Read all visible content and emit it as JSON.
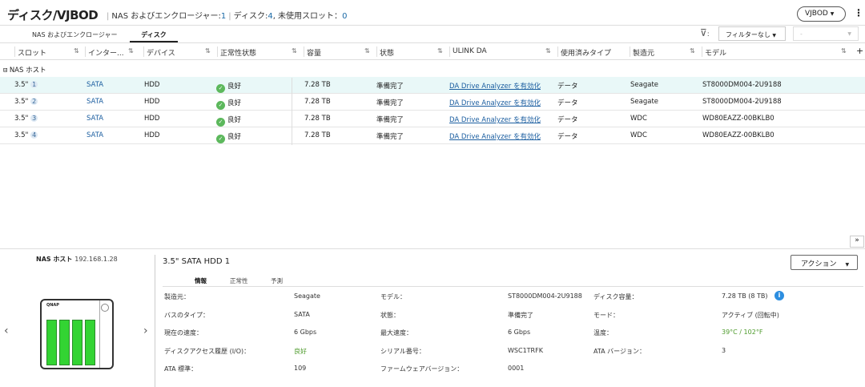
{
  "header": {
    "title": "ディスク/VJBOD",
    "nas_label": "NAS およびエンクロージャー:",
    "nas_count": "1",
    "disk_label": "ディスク:",
    "disk_count": "4",
    "free_label": ", 未使用スロット：",
    "free_count": "0",
    "vjbod_button": "VJBOD",
    "more_icon": "kebab-icon"
  },
  "tabs": [
    {
      "label": "NAS およびエンクロージャー",
      "active": false
    },
    {
      "label": "ディスク",
      "active": true
    }
  ],
  "filter": {
    "icon": "filter-icon",
    "label": ":",
    "selected": "フィルターなし",
    "second": "-"
  },
  "columns": [
    "スロット",
    "インター...",
    "デバイス",
    "正常性状態",
    "容量",
    "状態",
    "ULINK DA",
    "使用済みタイプ",
    "製造元",
    "モデル"
  ],
  "group": "NAS ホスト",
  "rows": [
    {
      "slot": "3.5\"",
      "num": "1",
      "iface": "SATA",
      "device": "HDD",
      "health": "良好",
      "capacity": "7.28 TB",
      "state": "準備完了",
      "ulink": "DA Drive Analyzer を有効化",
      "type": "データ",
      "maker": "Seagate",
      "model": "ST8000DM004-2U9188",
      "selected": true
    },
    {
      "slot": "3.5\"",
      "num": "2",
      "iface": "SATA",
      "device": "HDD",
      "health": "良好",
      "capacity": "7.28 TB",
      "state": "準備完了",
      "ulink": "DA Drive Analyzer を有効化",
      "type": "データ",
      "maker": "Seagate",
      "model": "ST8000DM004-2U9188",
      "selected": false
    },
    {
      "slot": "3.5\"",
      "num": "3",
      "iface": "SATA",
      "device": "HDD",
      "health": "良好",
      "capacity": "7.28 TB",
      "state": "準備完了",
      "ulink": "DA Drive Analyzer を有効化",
      "type": "データ",
      "maker": "WDC",
      "model": "WD80EAZZ-00BKLB0",
      "selected": false
    },
    {
      "slot": "3.5\"",
      "num": "4",
      "iface": "SATA",
      "device": "HDD",
      "health": "良好",
      "capacity": "7.28 TB",
      "state": "準備完了",
      "ulink": "DA Drive Analyzer を有効化",
      "type": "データ",
      "maker": "WDC",
      "model": "WD80EAZZ-00BKLB0",
      "selected": false
    }
  ],
  "host": {
    "label": "NAS ホスト",
    "ip": "192.168.1.28",
    "logo": "QNAP"
  },
  "detail": {
    "title": "3.5\" SATA HDD 1",
    "action": "アクション",
    "tabs": [
      "情報",
      "正常性",
      "予測"
    ],
    "fields": [
      {
        "label": "製造元：",
        "value": "Seagate"
      },
      {
        "label": "モデル：",
        "value": "ST8000DM004-2U9188"
      },
      {
        "label": "ディスク容量：",
        "value": "7.28 TB (8 TB)"
      },
      {
        "label": "バスのタイプ：",
        "value": "SATA"
      },
      {
        "label": "状態：",
        "value": "準備完了"
      },
      {
        "label": "モード：",
        "value": "アクティブ (回転中)"
      },
      {
        "label": "現在の速度：",
        "value": "6 Gbps"
      },
      {
        "label": "最大速度：",
        "value": "6 Gbps"
      },
      {
        "label": "温度：",
        "value": "39°C / 102°F"
      },
      {
        "label": "ディスクアクセス履歴 (I/O)：",
        "value": "良好"
      },
      {
        "label": "シリアル番号：",
        "value": "WSC1TRFK"
      },
      {
        "label": "ATA バージョン：",
        "value": "3"
      },
      {
        "label": "ATA 標準：",
        "value": "109"
      },
      {
        "label": "ファームウェアバージョン：",
        "value": "0001"
      }
    ]
  },
  "colors": {
    "accent": "#1b5ea0",
    "ok": "#5cb85c",
    "selected_row": "#e9f8f8",
    "bay": "#33d433"
  }
}
